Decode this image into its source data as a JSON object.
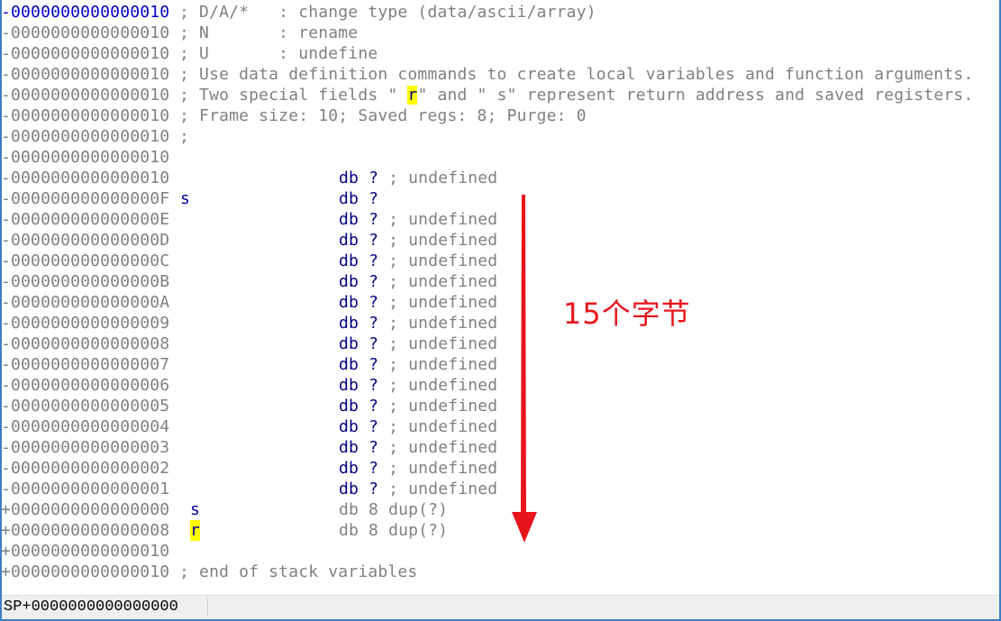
{
  "rows": [
    {
      "addr": "-0000000000000010",
      "current": true,
      "comment": [
        {
          "text": " ; D/A/*   : change type (data/ascii/array)"
        }
      ]
    },
    {
      "addr": "-0000000000000010",
      "comment": [
        {
          "text": " ; N       : rename"
        }
      ]
    },
    {
      "addr": "-0000000000000010",
      "comment": [
        {
          "text": " ; U       : undefine"
        }
      ]
    },
    {
      "addr": "-0000000000000010",
      "comment": [
        {
          "text": " ; Use data definition commands to create local variables and function arguments."
        }
      ]
    },
    {
      "addr": "-0000000000000010",
      "comment": [
        {
          "text": " ; Two special fields \" "
        },
        {
          "text": "r",
          "hl": true
        },
        {
          "text": "\" and \" s\" represent return address and saved registers."
        }
      ]
    },
    {
      "addr": "-0000000000000010",
      "comment": [
        {
          "text": " ; Frame size: 10; Saved regs: 8; Purge: 0"
        }
      ]
    },
    {
      "addr": "-0000000000000010",
      "comment": [
        {
          "text": " ;"
        }
      ]
    },
    {
      "addr": "-0000000000000010"
    },
    {
      "addr": "-0000000000000010",
      "kw": "db",
      "arg": "?",
      "tail": " ; undefined"
    },
    {
      "addr": "-000000000000000F",
      "name": "s",
      "kw": "db",
      "arg": "?",
      "tail": ""
    },
    {
      "addr": "-000000000000000E",
      "kw": "db",
      "arg": "?",
      "tail": " ; undefined"
    },
    {
      "addr": "-000000000000000D",
      "kw": "db",
      "arg": "?",
      "tail": " ; undefined"
    },
    {
      "addr": "-000000000000000C",
      "kw": "db",
      "arg": "?",
      "tail": " ; undefined"
    },
    {
      "addr": "-000000000000000B",
      "kw": "db",
      "arg": "?",
      "tail": " ; undefined"
    },
    {
      "addr": "-000000000000000A",
      "kw": "db",
      "arg": "?",
      "tail": " ; undefined"
    },
    {
      "addr": "-0000000000000009",
      "kw": "db",
      "arg": "?",
      "tail": " ; undefined"
    },
    {
      "addr": "-0000000000000008",
      "kw": "db",
      "arg": "?",
      "tail": " ; undefined"
    },
    {
      "addr": "-0000000000000007",
      "kw": "db",
      "arg": "?",
      "tail": " ; undefined"
    },
    {
      "addr": "-0000000000000006",
      "kw": "db",
      "arg": "?",
      "tail": " ; undefined"
    },
    {
      "addr": "-0000000000000005",
      "kw": "db",
      "arg": "?",
      "tail": " ; undefined"
    },
    {
      "addr": "-0000000000000004",
      "kw": "db",
      "arg": "?",
      "tail": " ; undefined"
    },
    {
      "addr": "-0000000000000003",
      "kw": "db",
      "arg": "?",
      "tail": " ; undefined"
    },
    {
      "addr": "-0000000000000002",
      "kw": "db",
      "arg": "?",
      "tail": " ; undefined"
    },
    {
      "addr": "-0000000000000001",
      "kw": "db",
      "arg": "?",
      "tail": " ; undefined"
    },
    {
      "addr": "+0000000000000000",
      "name": "s",
      "plain": "db 8 dup(?)"
    },
    {
      "addr": "+0000000000000008",
      "name": "r",
      "name_hl": true,
      "plain": "db 8 dup(?)"
    },
    {
      "addr": "+0000000000000010"
    },
    {
      "addr": "+0000000000000010",
      "comment": [
        {
          "text": " ; end of stack variables"
        }
      ]
    }
  ],
  "status": {
    "sp": "SP+0000000000000000"
  },
  "annotation": {
    "text": "15个字节",
    "color": "#e8141c",
    "arrow": "arrow-down"
  },
  "colors": {
    "address": "#808080",
    "current_address": "#0000c8",
    "keyword": "#000080",
    "highlight": "#ffff00",
    "border": "#3c7fc4"
  }
}
